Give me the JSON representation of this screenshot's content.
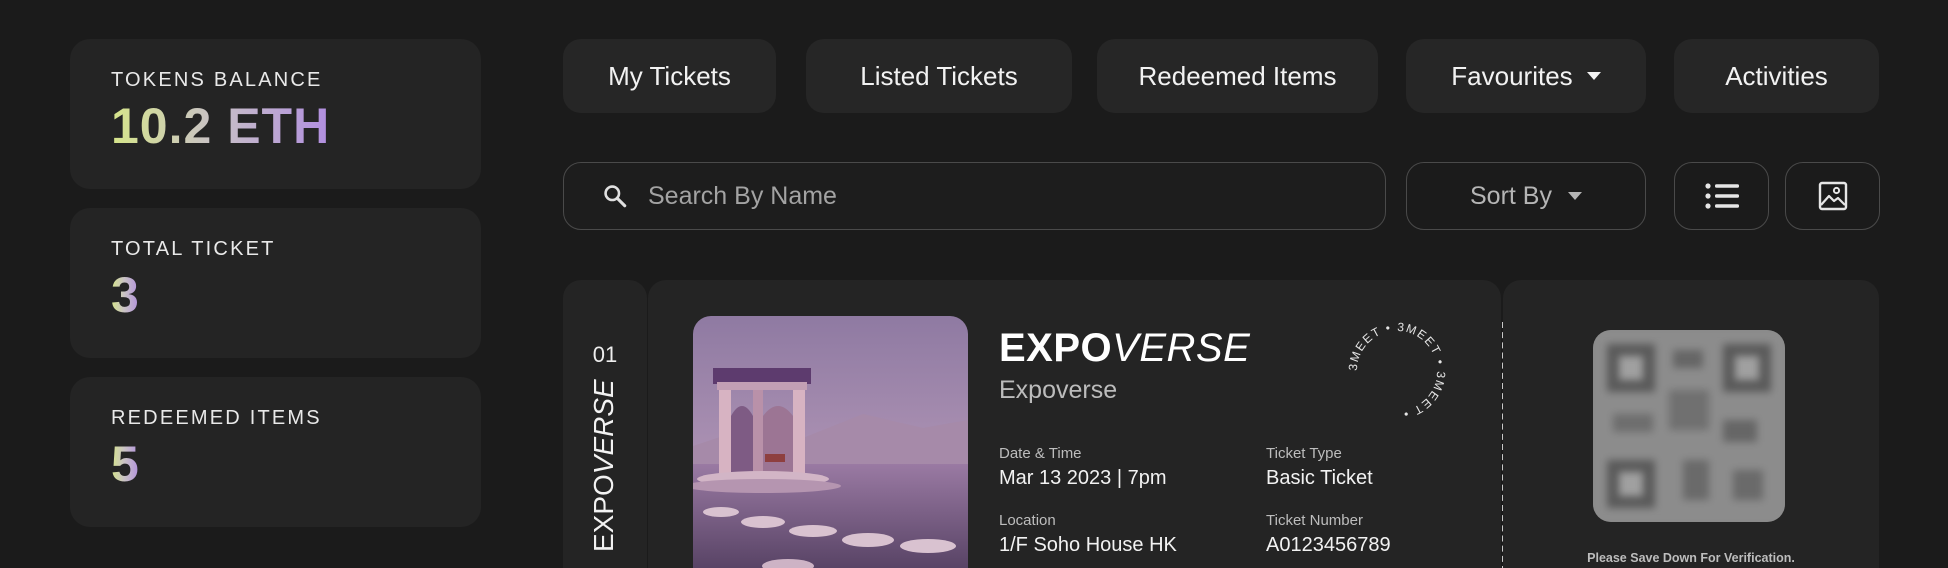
{
  "stats": [
    {
      "label": "TOKENS BALANCE",
      "value": "10.2 ETH"
    },
    {
      "label": "TOTAL TICKET",
      "value": "3"
    },
    {
      "label": "REDEEMED ITEMS",
      "value": "5"
    }
  ],
  "tabs": [
    {
      "label": "My Tickets"
    },
    {
      "label": "Listed Tickets"
    },
    {
      "label": "Redeemed Items"
    },
    {
      "label": "Favourites"
    },
    {
      "label": "Activities"
    }
  ],
  "toolbar": {
    "search_placeholder": "Search By Name",
    "sort_label": "Sort By"
  },
  "ticket": {
    "index": "01",
    "stub_brand_bold": "EXPO",
    "stub_brand_italic": "VERSE",
    "brand_bold": "EXPO",
    "brand_italic": "VERSE",
    "subtitle": "Expoverse",
    "fields": {
      "date_label": "Date & Time",
      "date_value": "Mar 13 2023 | 7pm",
      "type_label": "Ticket Type",
      "type_value": "Basic Ticket",
      "location_label": "Location",
      "location_value": "1/F Soho House HK",
      "number_label": "Ticket Number",
      "number_value": "A0123456789"
    },
    "seal_text": "3MEET • 3MEET • 3MEET • ",
    "qr_note": "Please Save Down For Verification."
  },
  "colors": {
    "background": "#1b1b1b",
    "card": "#242424",
    "border": "#4a4a4a",
    "gradient_start": "#d6e58a",
    "gradient_end": "#b18ee0"
  },
  "icons": {
    "search": "search-icon",
    "sort": "chevron-down-icon",
    "list_view": "list-icon",
    "image_view": "image-icon"
  }
}
